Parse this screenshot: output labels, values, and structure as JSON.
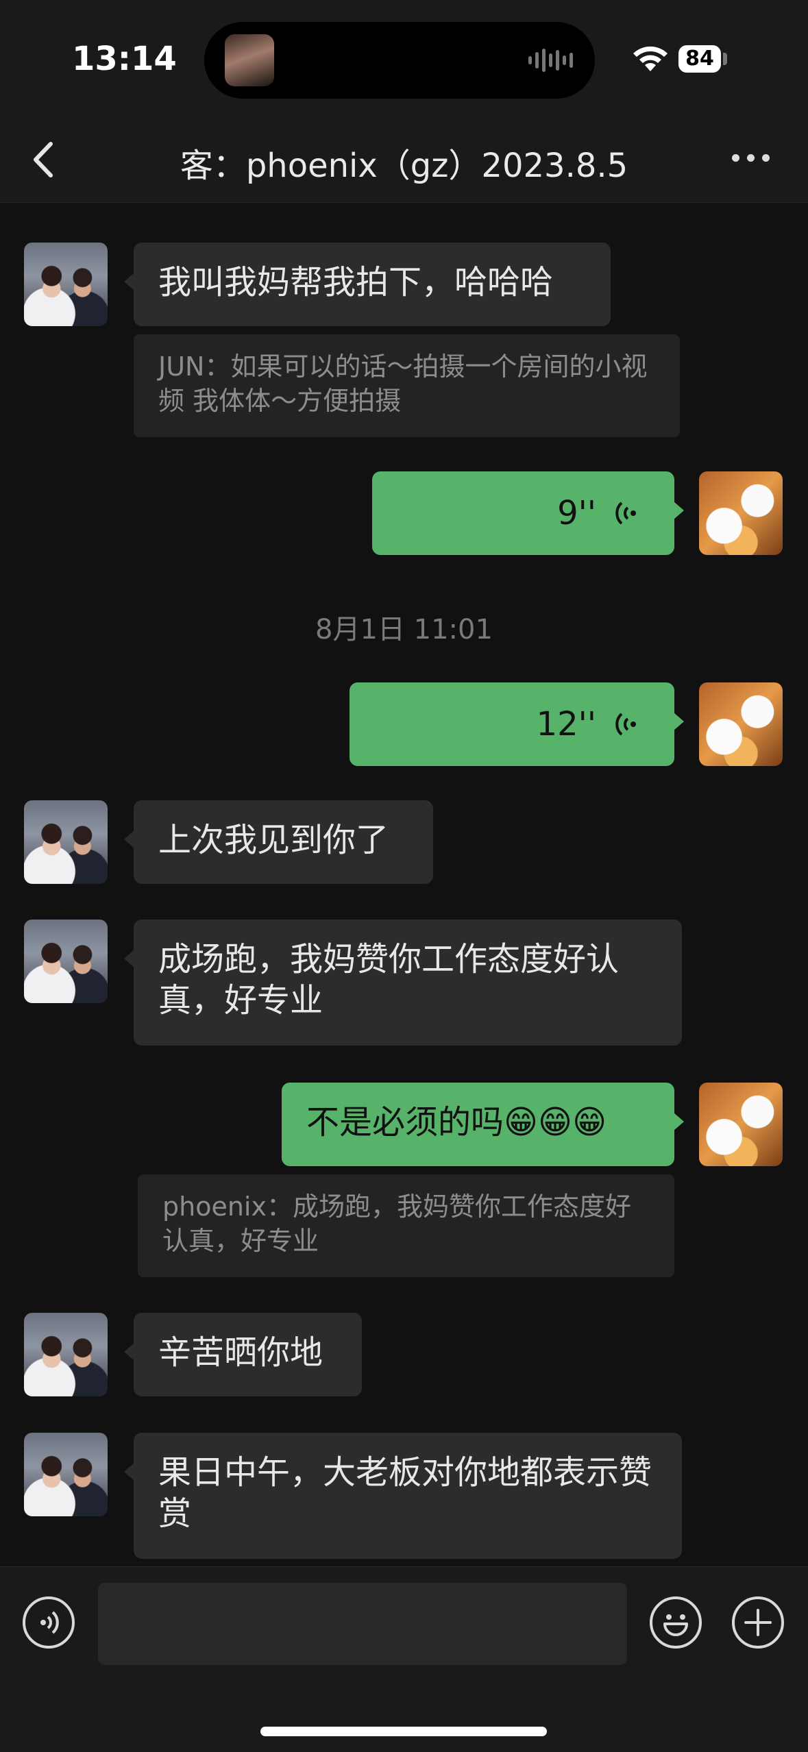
{
  "status_bar": {
    "time": "13:14",
    "battery": "84"
  },
  "nav": {
    "title": "客：phoenix（gz）2023.8.5"
  },
  "messages": {
    "m1": {
      "text": "我叫我妈帮我拍下，哈哈哈"
    },
    "q1": {
      "text": "JUN：如果可以的话～拍摄一个房间的小视频 我体体～方便拍摄"
    },
    "v1": {
      "duration": "9''"
    },
    "ts1": {
      "text": "8月1日 11:01"
    },
    "v2": {
      "duration": "12''"
    },
    "m2": {
      "text": "上次我见到你了"
    },
    "m3": {
      "text": "成场跑，我妈赞你工作态度好认真，好专业"
    },
    "m4": {
      "text": "不是必须的吗😁😁😁"
    },
    "q2": {
      "text": "phoenix：成场跑，我妈赞你工作态度好认真，好专业"
    },
    "m5": {
      "text": "辛苦晒你地"
    },
    "m6": {
      "text": "果日中午，大老板对你地都表示赞赏"
    }
  },
  "colors": {
    "bubble_green": "#57b36a",
    "bubble_dark": "#2c2c2c",
    "background": "#111111"
  },
  "icons": [
    "back-chevron-icon",
    "more-icon",
    "voice-wave-icon",
    "voice-input-icon",
    "emoji-icon",
    "plus-icon"
  ]
}
